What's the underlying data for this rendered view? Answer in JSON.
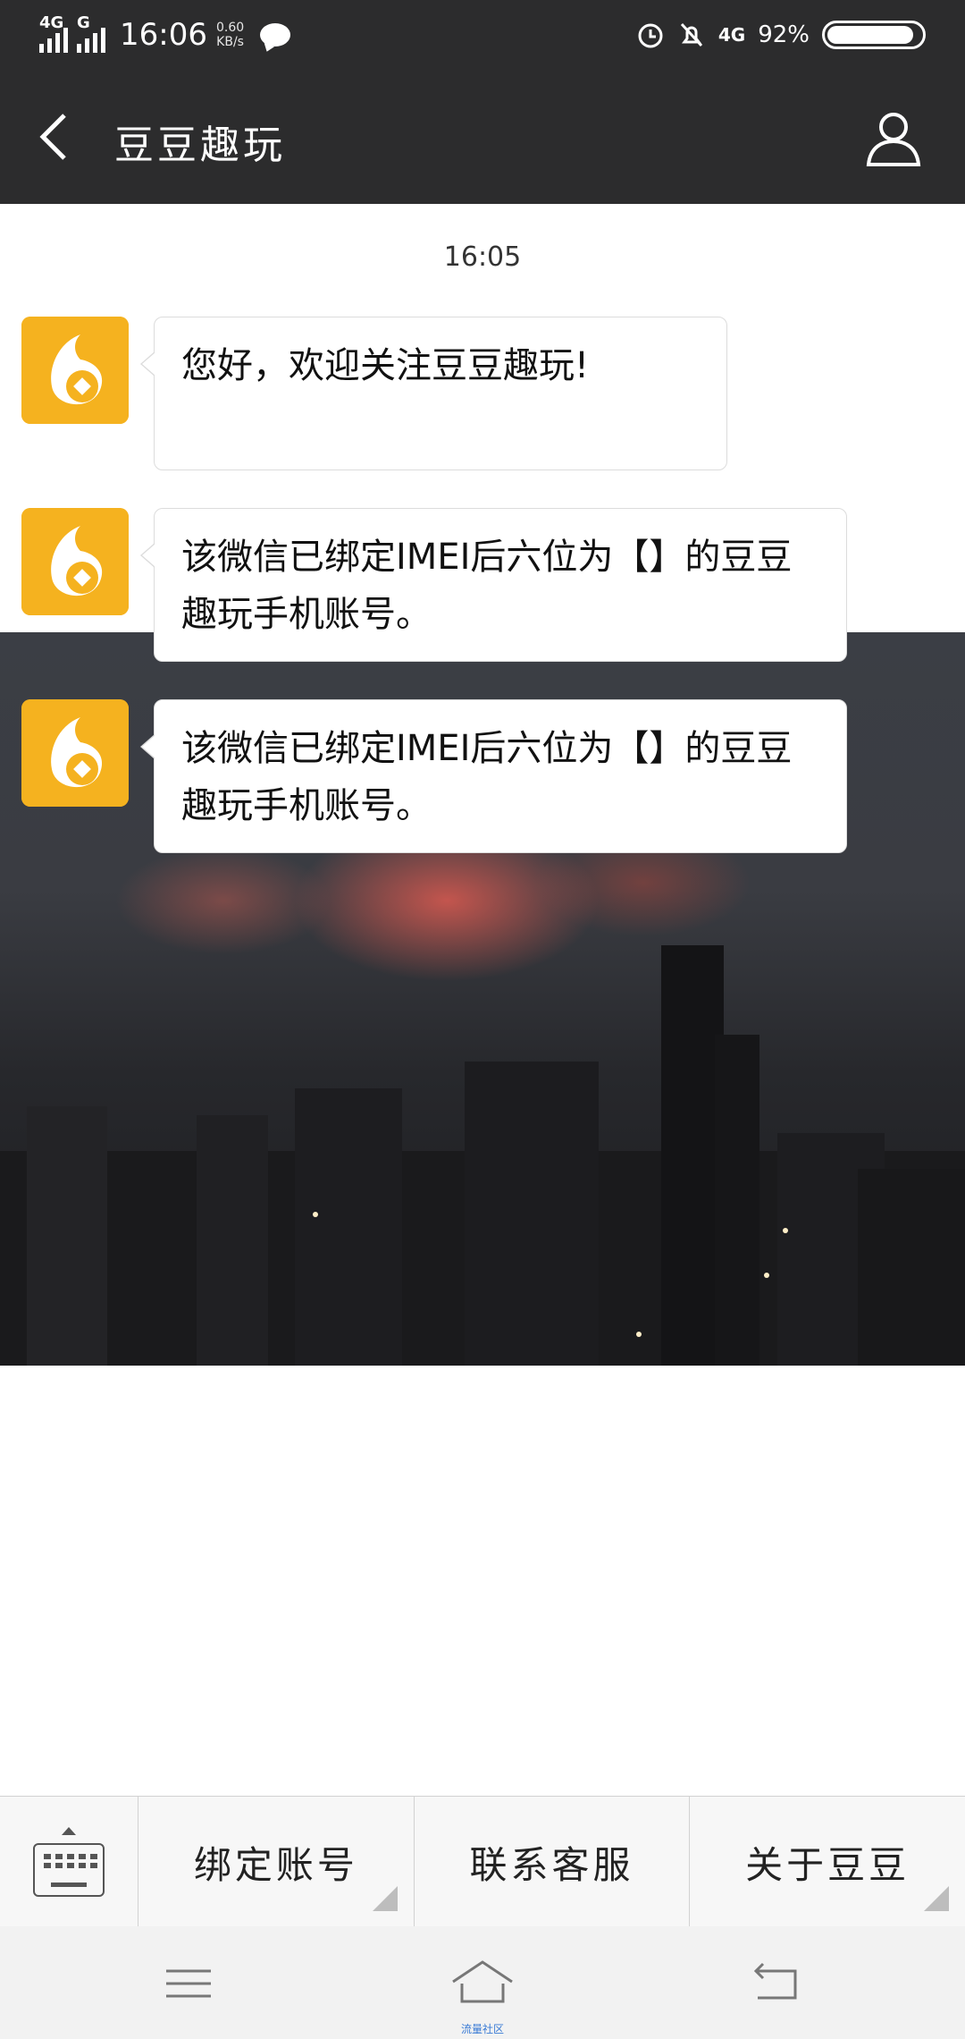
{
  "status_bar": {
    "signal1_label": "4G",
    "signal2_label": "G",
    "time": "16:06",
    "speed_value": "0.60",
    "speed_unit": "KB/s",
    "network_right": "4G",
    "battery_text": "92%",
    "battery_level": 0.92
  },
  "header": {
    "title": "豆豆趣玩"
  },
  "chat": {
    "timestamp": "16:05",
    "messages": [
      {
        "text": "您好，欢迎关注豆豆趣玩!"
      },
      {
        "text": "该微信已绑定IMEI后六位为【】的豆豆趣玩手机账号。"
      },
      {
        "text": "该微信已绑定IMEI后六位为【】的豆豆趣玩手机账号。"
      }
    ]
  },
  "menu": {
    "items": [
      {
        "label": "绑定账号"
      },
      {
        "label": "联系客服"
      },
      {
        "label": "关于豆豆"
      }
    ]
  },
  "navbar": {
    "watermark": "流量社区"
  },
  "colors": {
    "header_bg": "#2c2c2d",
    "avatar_bg": "#f5b21f"
  }
}
